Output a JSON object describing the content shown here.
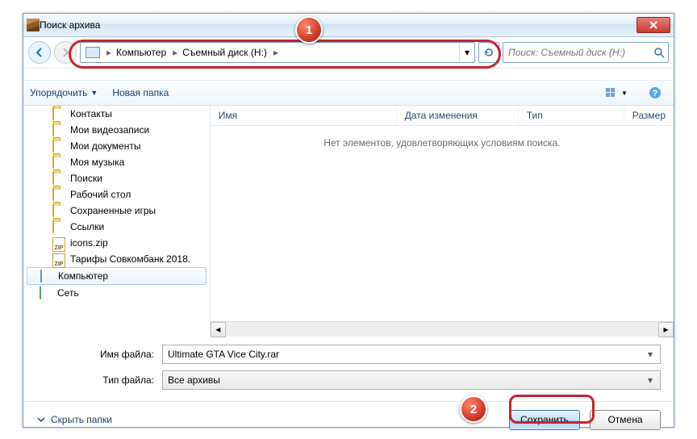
{
  "window": {
    "title": "Поиск архива"
  },
  "nav": {
    "breadcrumb": {
      "seg1": "Компьютер",
      "seg2": "Съемный диск (H:)"
    },
    "search_placeholder": "Поиск: Съемный диск (H:)"
  },
  "toolbar": {
    "organize": "Упорядочить",
    "new_folder": "Новая папка"
  },
  "tree": {
    "items": [
      {
        "label": "Контакты",
        "type": "folder"
      },
      {
        "label": "Мои видеозаписи",
        "type": "folder"
      },
      {
        "label": "Мои документы",
        "type": "folder"
      },
      {
        "label": "Моя музыка",
        "type": "folder"
      },
      {
        "label": "Поиски",
        "type": "folder"
      },
      {
        "label": "Рабочий стол",
        "type": "folder"
      },
      {
        "label": "Сохраненные игры",
        "type": "folder"
      },
      {
        "label": "Ссылки",
        "type": "folder"
      },
      {
        "label": "icons.zip",
        "type": "zip"
      },
      {
        "label": "Тарифы Совкомбанк 2018.",
        "type": "zip"
      },
      {
        "label": "Компьютер",
        "type": "computer",
        "selected": true
      },
      {
        "label": "Сеть",
        "type": "network"
      }
    ]
  },
  "columns": {
    "name": "Имя",
    "date": "Дата изменения",
    "type": "Тип",
    "size": "Размер"
  },
  "list": {
    "empty_text": "Нет элементов, удовлетворяющих условиям поиска."
  },
  "form": {
    "filename_label": "Имя файла:",
    "filename_value": "Ultimate GTA Vice City.rar",
    "filetype_label": "Тип файла:",
    "filetype_value": "Все архивы"
  },
  "footer": {
    "hide_folders": "Скрыть папки",
    "save": "Сохранить",
    "cancel": "Отмена"
  },
  "markers": {
    "m1": "1",
    "m2": "2"
  }
}
